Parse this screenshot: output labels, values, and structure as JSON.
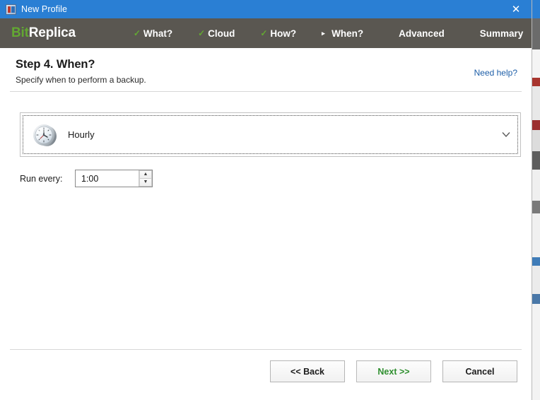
{
  "window": {
    "title": "New Profile",
    "app_icon": "app-icon",
    "close_label": "✕"
  },
  "nav": {
    "brand_first": "Bit",
    "brand_second": "Replica",
    "items": [
      {
        "label": "What?",
        "marker": "check",
        "state": "completed"
      },
      {
        "label": "Cloud",
        "marker": "check",
        "state": "completed"
      },
      {
        "label": "How?",
        "marker": "check",
        "state": "completed"
      },
      {
        "label": "When?",
        "marker": "arrow",
        "state": "current"
      },
      {
        "label": "Advanced",
        "marker": "none",
        "state": "upcoming"
      },
      {
        "label": "Summary",
        "marker": "none",
        "state": "upcoming"
      }
    ],
    "check_glyph": "✓",
    "arrow_glyph": "▸"
  },
  "header": {
    "title": "Step 4. When?",
    "subtitle": "Specify when to perform a backup.",
    "help_link": "Need help?"
  },
  "schedule": {
    "selected_label": "Hourly",
    "icon": "clock-icon",
    "chevron": "∨",
    "options": [
      "Hourly"
    ]
  },
  "interval": {
    "label": "Run every:",
    "value": "1:00",
    "spinner_up": "▲",
    "spinner_down": "▼"
  },
  "footer": {
    "back_label": "<< Back",
    "next_label": "Next >>",
    "cancel_label": "Cancel"
  },
  "colors": {
    "titlebar": "#2a7fd4",
    "navbar": "#5a5751",
    "brand_accent": "#63a832",
    "link": "#1d5ea8",
    "primary_button_text": "#2f8f2f"
  }
}
